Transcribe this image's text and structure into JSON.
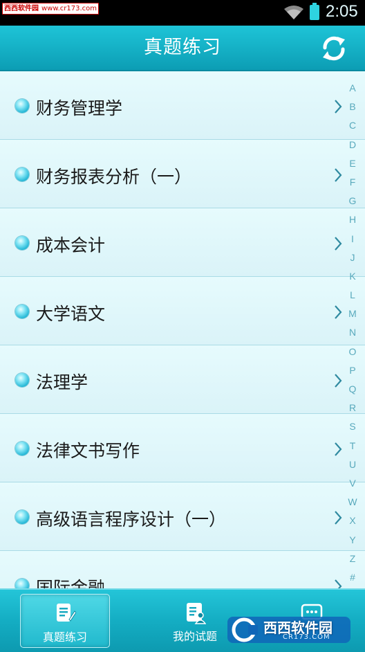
{
  "status_bar": {
    "watermark_site": "西西软件园",
    "watermark_url": "www.cr173.com",
    "time": "2:05",
    "wifi_icon": "wifi-icon",
    "battery_icon": "battery-icon"
  },
  "header": {
    "title": "真题练习",
    "refresh_icon": "refresh-icon"
  },
  "subjects": [
    {
      "label": "财务管理学"
    },
    {
      "label": "财务报表分析（一）"
    },
    {
      "label": "成本会计"
    },
    {
      "label": "大学语文"
    },
    {
      "label": "法理学"
    },
    {
      "label": "法律文书写作"
    },
    {
      "label": "高级语言程序设计（一）"
    },
    {
      "label": "国际金融"
    }
  ],
  "index_letters": [
    "A",
    "B",
    "C",
    "D",
    "E",
    "F",
    "G",
    "H",
    "I",
    "J",
    "K",
    "L",
    "M",
    "N",
    "O",
    "P",
    "Q",
    "R",
    "S",
    "T",
    "U",
    "V",
    "W",
    "X",
    "Y",
    "Z",
    "#"
  ],
  "bottom_nav": {
    "tabs": [
      {
        "label": "真题练习",
        "icon": "edit-document-icon",
        "active": true
      },
      {
        "label": "我的试题",
        "icon": "user-document-icon",
        "active": false
      },
      {
        "label": "",
        "icon": "message-icon",
        "active": false
      }
    ]
  },
  "watermark_logo": {
    "text": "西西软件园",
    "url": "CR173.COM"
  },
  "colors": {
    "accent": "#16b3c8",
    "list_bg": "#e6fbfd",
    "index_letter": "#58a9bc"
  }
}
